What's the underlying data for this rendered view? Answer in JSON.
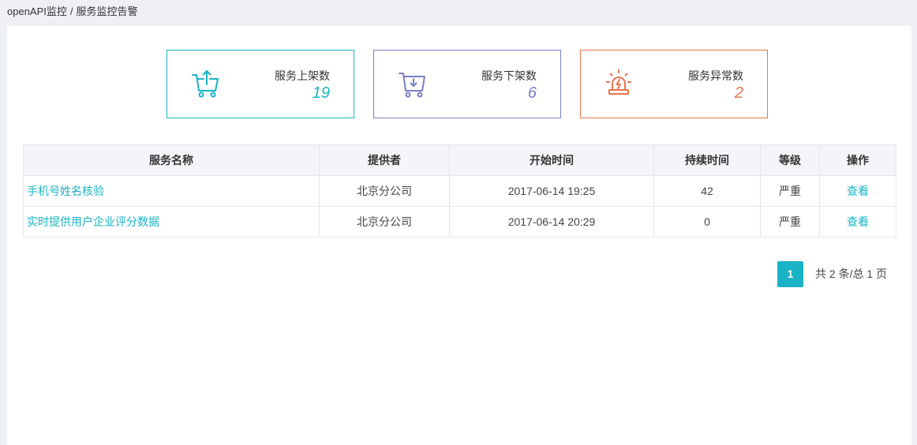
{
  "theme": {
    "accent": "#1ab3c6"
  },
  "breadcrumb": {
    "root": "openAPI监控",
    "separator": "/",
    "current": "服务监控告警"
  },
  "stats": [
    {
      "label": "服务上架数",
      "value": "19",
      "icon": "cart-up-icon",
      "color": "#1ab3c6"
    },
    {
      "label": "服务下架数",
      "value": "6",
      "icon": "cart-down-icon",
      "color": "#7b7fc4"
    },
    {
      "label": "服务异常数",
      "value": "2",
      "icon": "alarm-icon",
      "color": "#e9734b"
    }
  ],
  "table": {
    "columns": [
      "服务名称",
      "提供者",
      "开始时间",
      "持续时间",
      "等级",
      "操作"
    ],
    "rows": [
      {
        "name": "手机号姓名核验",
        "provider": "北京分公司",
        "start": "2017-06-14 19:25",
        "duration": "42",
        "level": "严重",
        "action": "查看"
      },
      {
        "name": "实时提供用户企业评分数据",
        "provider": "北京分公司",
        "start": "2017-06-14 20:29",
        "duration": "0",
        "level": "严重",
        "action": "查看"
      }
    ]
  },
  "pagination": {
    "current": "1",
    "summary": "共 2 条/总 1 页"
  }
}
